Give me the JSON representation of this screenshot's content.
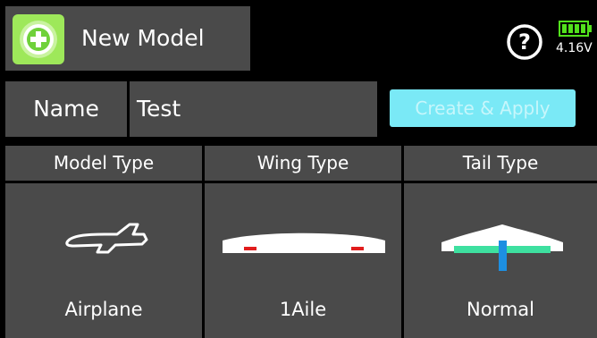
{
  "header": {
    "app_icon": "plus-in-gear-icon",
    "title": "New Model",
    "help_icon": "question-mark-icon",
    "battery_icon": "battery-icon",
    "battery_color": "#52e11c",
    "battery_level": 1.0,
    "voltage": "4.16V"
  },
  "name_row": {
    "label": "Name",
    "value": "Test"
  },
  "create_button": {
    "label": "Create & Apply",
    "color": "#7ae9f6"
  },
  "columns": [
    {
      "header": "Model Type",
      "value": "Airplane",
      "icon": "airplane-icon"
    },
    {
      "header": "Wing Type",
      "value": "1Aile",
      "icon": "wing-icon"
    },
    {
      "header": "Tail Type",
      "value": "Normal",
      "icon": "tail-icon"
    }
  ],
  "colors": {
    "panel": "#4a4a4a",
    "background": "#000000",
    "accent_green": "#3ee0a0",
    "aileron_red": "#e11d1d",
    "rudder_blue": "#1d8fe1"
  }
}
